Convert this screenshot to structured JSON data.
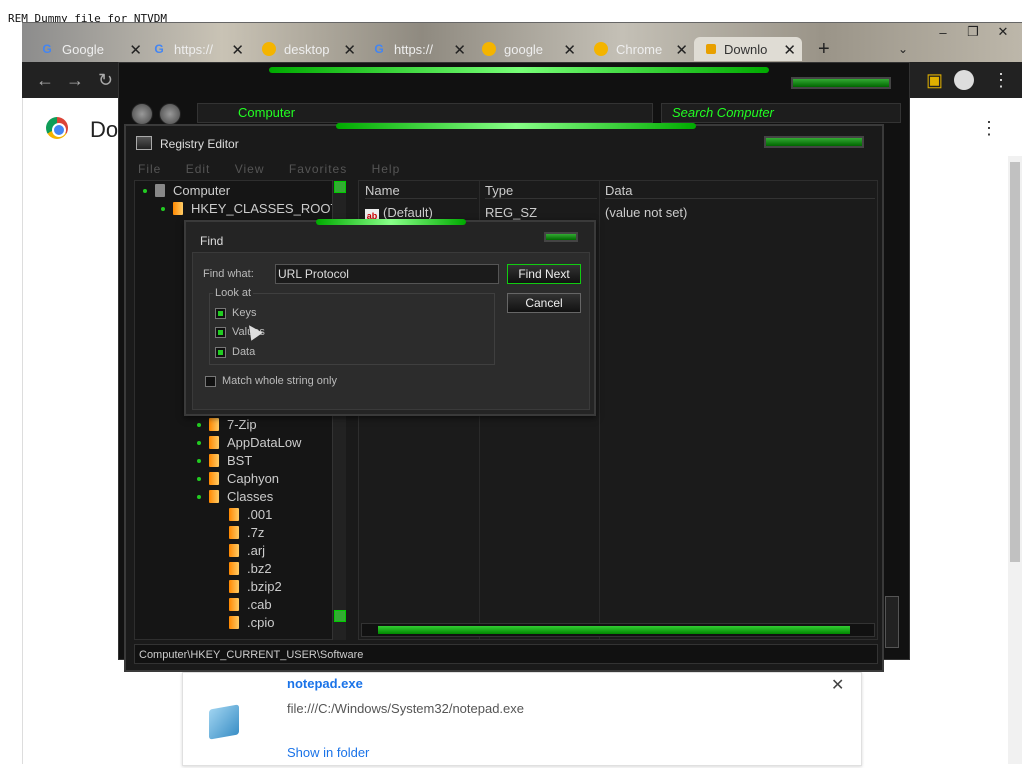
{
  "rem_line": "REM Dummy file for NTVDM",
  "browser": {
    "tabs": [
      {
        "label": "Google",
        "icon": "google-icon"
      },
      {
        "label": "https://",
        "icon": "google-icon"
      },
      {
        "label": "desktop",
        "icon": "chrome-icon"
      },
      {
        "label": "https://",
        "icon": "google-icon"
      },
      {
        "label": "google",
        "icon": "chrome-icon"
      },
      {
        "label": "Chrome",
        "icon": "chrome-icon"
      },
      {
        "label": "Downlo",
        "icon": "download-icon"
      }
    ],
    "new_tab": "+",
    "window_buttons": [
      "–",
      "❐",
      "✕"
    ],
    "page_title": "Do",
    "download": {
      "filename": "notepad.exe",
      "url": "file:///C:/Windows/System32/notepad.exe",
      "show_in_folder": "Show in folder"
    }
  },
  "explorer": {
    "address": "Computer",
    "search_placeholder": "Search Computer"
  },
  "registry": {
    "title": "Registry Editor",
    "menu": [
      "File",
      "Edit",
      "View",
      "Favorites",
      "Help"
    ],
    "tree": {
      "computer": "Computer",
      "hkcr": "HKEY_CLASSES_ROOT",
      "items": [
        "7-Zip",
        "AppDataLow",
        "BST",
        "Caphyon",
        "Classes"
      ],
      "classes_children": [
        ".001",
        ".7z",
        ".arj",
        ".bz2",
        ".bzip2",
        ".cab",
        ".cpio"
      ]
    },
    "columns": {
      "name": "Name",
      "type": "Type",
      "data": "Data"
    },
    "rows": [
      {
        "name": "(Default)",
        "type": "REG_SZ",
        "data": "(value not set)"
      }
    ],
    "status": "Computer\\HKEY_CURRENT_USER\\Software"
  },
  "find_dialog": {
    "title": "Find",
    "find_what_label": "Find what:",
    "find_what_value": "URL Protocol",
    "find_next": "Find Next",
    "cancel": "Cancel",
    "look_at": "Look at",
    "keys": "Keys",
    "values": "Values",
    "data": "Data",
    "match_whole": "Match whole string only",
    "keys_checked": true,
    "values_checked": true,
    "data_checked": true,
    "match_checked": false
  }
}
